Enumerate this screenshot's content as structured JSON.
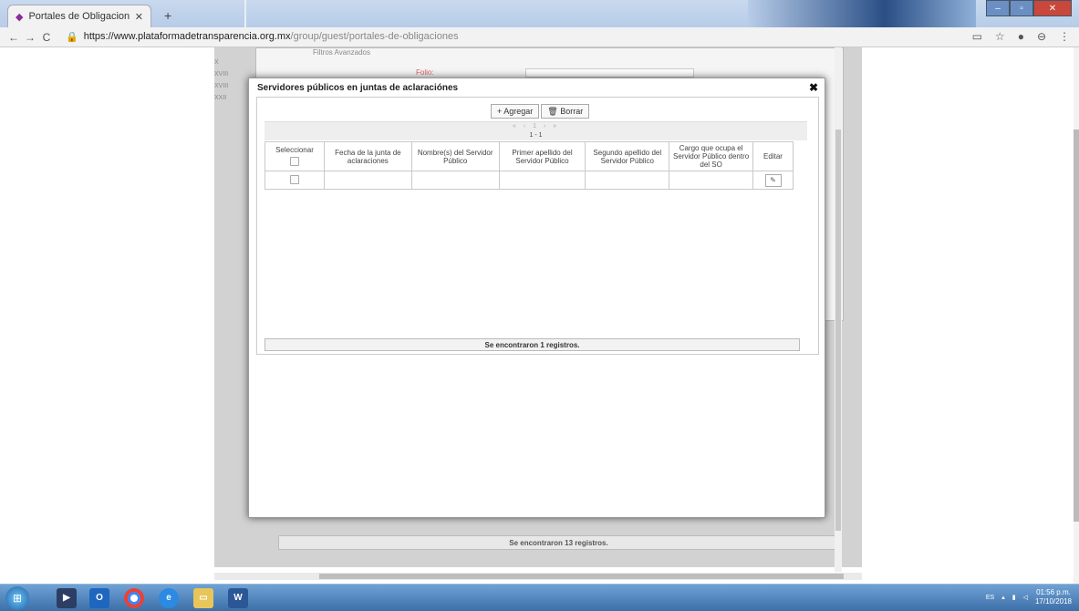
{
  "browser": {
    "tab_title": "Portales de Obligaciones de Tra",
    "tab_close": "✕",
    "new_tab": "+",
    "url_host": "https://www.plataformadetransparencia.org.mx",
    "url_path": "/group/guest/portales-de-obligaciones",
    "nav": {
      "back": "←",
      "forward": "→",
      "reload": "C"
    }
  },
  "background": {
    "filter_title": "Filtros Avanzados",
    "folio_label": "Folio:",
    "roman_items": [
      "X",
      "XVIII",
      "XVIII",
      "XXII"
    ],
    "footer": "Se encontraron 13 registros."
  },
  "modal": {
    "title": "Servidores públicos en juntas de aclaraciónes",
    "close": "✖",
    "toolbar": {
      "add_label": "+ Agregar",
      "delete_label": "🗑 Borrar"
    },
    "pager": {
      "count": "1 - 1"
    },
    "table": {
      "headers": [
        "Seleccionar",
        "Fecha de la junta de aclaraciones",
        "Nombre(s) del Servidor Público",
        "Primer apellido del Servidor Público",
        "Segundo apellido del Servidor Público",
        "Cargo que ocupa el Servidor Público dentro del SO",
        "Editar"
      ],
      "rows": [
        {
          "fecha": "",
          "nombre": "",
          "primer": "",
          "segundo": "",
          "cargo": ""
        }
      ]
    },
    "footer": "Se encontraron 1 registros."
  },
  "taskbar": {
    "lang": "ES",
    "time": "01:56 p.m.",
    "date": "17/10/2018"
  }
}
